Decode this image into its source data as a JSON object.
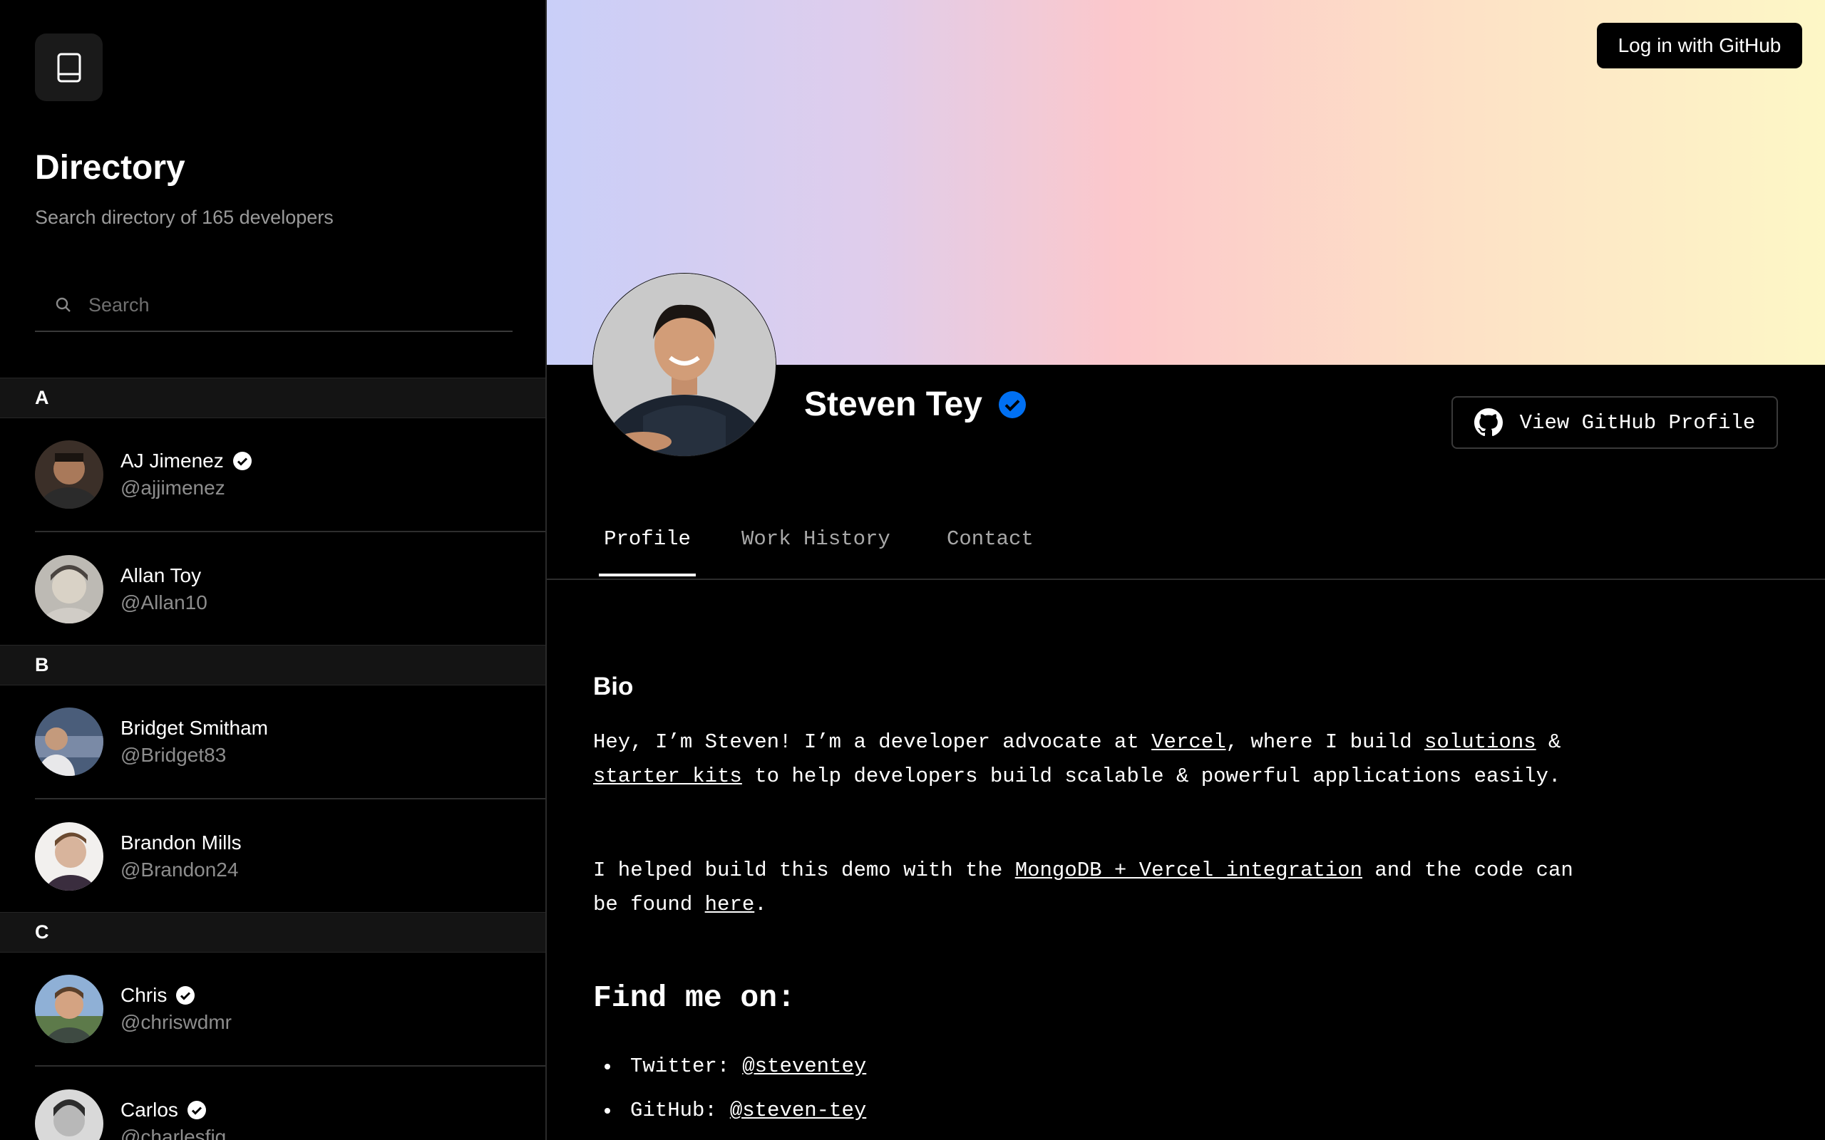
{
  "sidebar": {
    "title": "Directory",
    "subtitle": "Search directory of 165 developers",
    "search_placeholder": "Search",
    "groups": [
      {
        "letter": "A",
        "people": [
          {
            "name": "AJ Jimenez",
            "handle": "@ajjimenez",
            "verified": true
          },
          {
            "name": "Allan Toy",
            "handle": "@Allan10",
            "verified": false
          }
        ]
      },
      {
        "letter": "B",
        "people": [
          {
            "name": "Bridget Smitham",
            "handle": "@Bridget83",
            "verified": false
          },
          {
            "name": "Brandon Mills",
            "handle": "@Brandon24",
            "verified": false
          }
        ]
      },
      {
        "letter": "C",
        "people": [
          {
            "name": "Chris",
            "handle": "@chriswdmr",
            "verified": true
          },
          {
            "name": "Carlos",
            "handle": "@charlesfig",
            "verified": true
          }
        ]
      }
    ]
  },
  "header": {
    "login_label": "Log in with GitHub"
  },
  "profile": {
    "name": "Steven Tey",
    "verified": true,
    "github_button_label": "View GitHub Profile",
    "tabs": [
      {
        "label": "Profile",
        "active": true
      },
      {
        "label": "Work History",
        "active": false
      },
      {
        "label": "Contact",
        "active": false
      }
    ],
    "bio_title": "Bio",
    "bio": {
      "p1_a": "Hey, I’m Steven! I’m a developer advocate at ",
      "p1_link1": "Vercel",
      "p1_b": ", where I build ",
      "p1_link2": "solutions",
      "p1_c": " & ",
      "p1_link3": "starter kits",
      "p1_d": " to help developers build scalable & powerful applications easily.",
      "p2_a": "I helped build this demo with the ",
      "p2_link1": "MongoDB + Vercel integration",
      "p2_b": " and the code can be found ",
      "p2_link2": "here",
      "p2_c": "."
    },
    "find_title": "Find me on:",
    "socials": [
      {
        "label": "Twitter:",
        "handle": "@steventey"
      },
      {
        "label": "GitHub:",
        "handle": "@steven-tey"
      }
    ]
  },
  "colors": {
    "verified_blue": "#0070f3",
    "banner_start": "#c9cff8",
    "banner_mid": "#fcc8cb",
    "banner_end": "#fdf7c6"
  }
}
